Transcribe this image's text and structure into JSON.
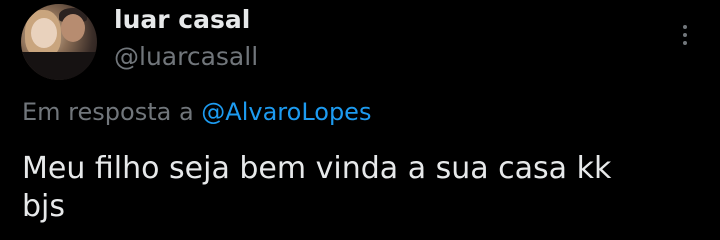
{
  "author": {
    "name": "luar casal",
    "handle": "@luarcasall"
  },
  "reply": {
    "prefix": "Em resposta a ",
    "mention": "@AlvaroLopes"
  },
  "tweet": {
    "line1": "Meu filho seja bem vinda a sua casa kk",
    "line2": "bjs"
  },
  "icons": {
    "more": "more-vertical-icon"
  },
  "colors": {
    "background": "#000000",
    "text": "#e7e9ea",
    "muted": "#71767b",
    "accent": "#1d9bf0"
  }
}
